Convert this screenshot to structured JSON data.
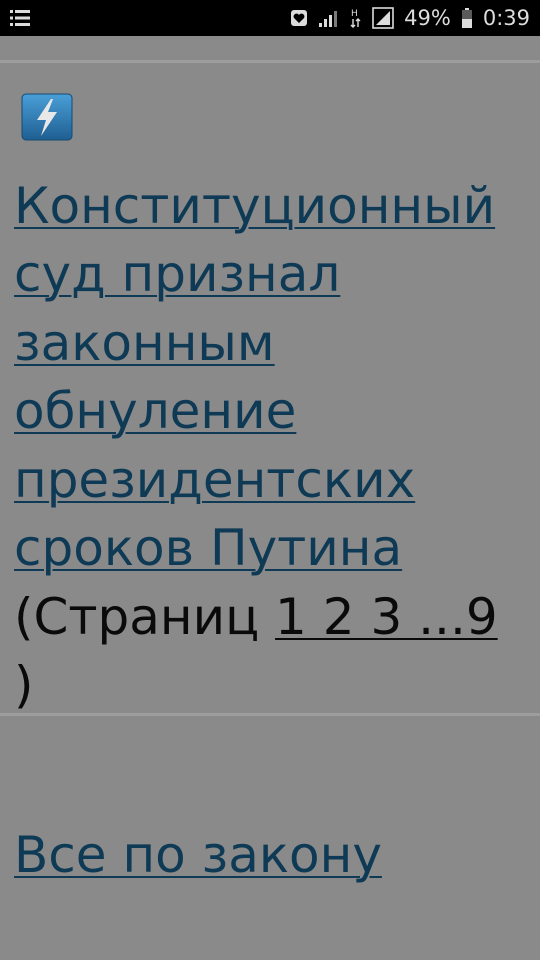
{
  "status_bar": {
    "battery": "49%",
    "time": "0:39",
    "icons": [
      "menu-icon",
      "heart-box-icon",
      "signal-icon",
      "hplus-network-icon",
      "signal-icon",
      "battery-icon"
    ]
  },
  "article": {
    "icon": "high-voltage-icon",
    "title": "Конституционный суд признал законным обнуление президентских сроков Путина",
    "pages_prefix": "(Страниц ",
    "pages_links": "1 2 3 ...9",
    "pages_suffix": ")"
  },
  "bottom": {
    "link": "Все по закону"
  },
  "colors": {
    "background": "#8a8a8a",
    "link": "#0e3a55",
    "statusbar": "#000000",
    "icon_blue": "#2a7fbf"
  }
}
